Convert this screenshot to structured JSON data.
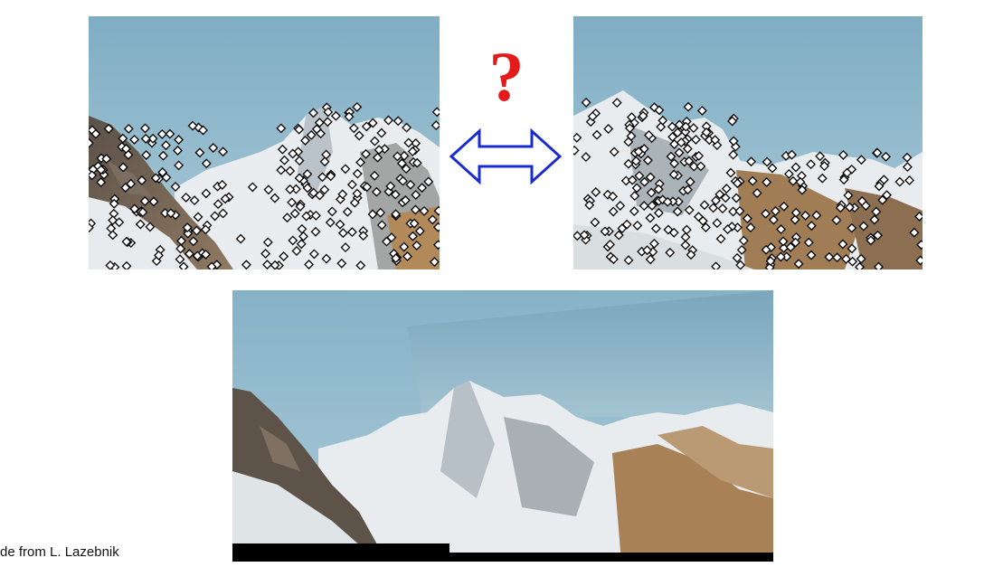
{
  "slide": {
    "question_mark": "?",
    "credit": "de from L. Lazebnik"
  },
  "colors": {
    "question_mark": "#e31b1b",
    "arrow_stroke": "#1a2cd0",
    "sky": "#8fb8cb",
    "snow": "#eef1f3",
    "rock": "#6e6458",
    "keypoint_fill": "#ffffff",
    "keypoint_stroke": "#000000"
  },
  "images": {
    "left": "mountain-left-photo-with-keypoints",
    "right": "mountain-right-photo-with-keypoints",
    "panorama": "stitched-mountain-panorama"
  }
}
